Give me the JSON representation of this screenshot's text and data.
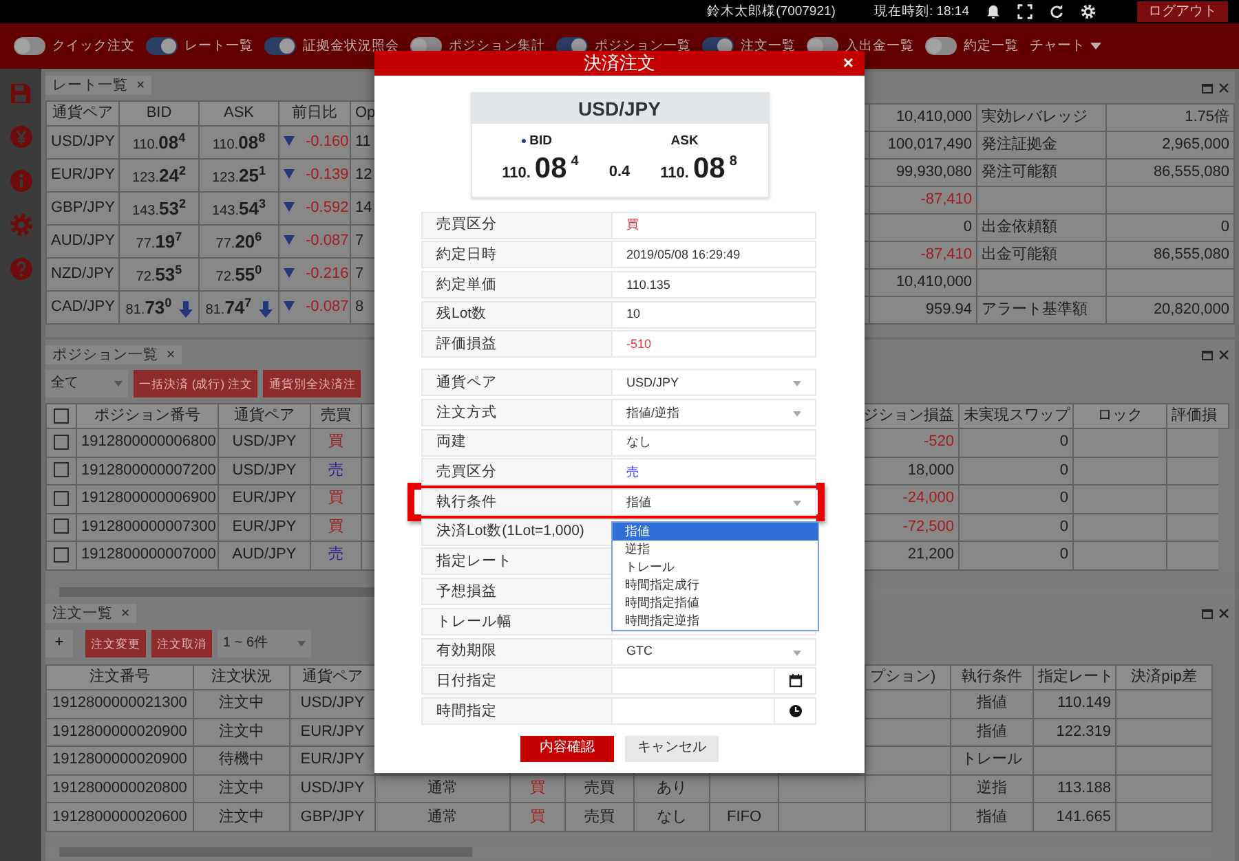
{
  "topbar": {
    "user": "鈴木太郎様(7007921)",
    "clock": "現在時刻: 18:14",
    "logout": "ログアウト"
  },
  "toolbar": {
    "toggles": [
      {
        "label": "クイック注文",
        "on": false
      },
      {
        "label": "レート一覧",
        "on": true
      },
      {
        "label": "証拠金状況照会",
        "on": true
      },
      {
        "label": "ポジション集計",
        "on": false
      },
      {
        "label": "ポジション一覧",
        "on": true
      },
      {
        "label": "注文一覧",
        "on": true
      },
      {
        "label": "入出金一覧",
        "on": false
      },
      {
        "label": "約定一覧",
        "on": false
      }
    ],
    "chart_menu": "チャート"
  },
  "rate_panel": {
    "tab": "レート一覧",
    "close": "×",
    "columns": [
      "通貨ペア",
      "BID",
      "ASK",
      "前日比",
      "Op"
    ],
    "rows": [
      {
        "pair": "USD/JPY",
        "bid": {
          "base": "110.",
          "pips": "08",
          "fraction": "4"
        },
        "ask": {
          "base": "110.",
          "pips": "08",
          "fraction": "8"
        },
        "falling": false,
        "change": "-0.160",
        "open": "11"
      },
      {
        "pair": "EUR/JPY",
        "bid": {
          "base": "123.",
          "pips": "24",
          "fraction": "2"
        },
        "ask": {
          "base": "123.",
          "pips": "25",
          "fraction": "1"
        },
        "falling": false,
        "change": "-0.139",
        "open": "12"
      },
      {
        "pair": "GBP/JPY",
        "bid": {
          "base": "143.",
          "pips": "53",
          "fraction": "2"
        },
        "ask": {
          "base": "143.",
          "pips": "54",
          "fraction": "3"
        },
        "falling": false,
        "change": "-0.592",
        "open": "14"
      },
      {
        "pair": "AUD/JPY",
        "bid": {
          "base": "77.",
          "pips": "19",
          "fraction": "7"
        },
        "ask": {
          "base": "77.",
          "pips": "20",
          "fraction": "6"
        },
        "falling": false,
        "change": "-0.087",
        "open": "7"
      },
      {
        "pair": "NZD/JPY",
        "bid": {
          "base": "72.",
          "pips": "53",
          "fraction": "5"
        },
        "ask": {
          "base": "72.",
          "pips": "55",
          "fraction": "0"
        },
        "falling": false,
        "change": "-0.216",
        "open": "7"
      },
      {
        "pair": "CAD/JPY",
        "bid": {
          "base": "81.",
          "pips": "73",
          "fraction": "0"
        },
        "ask": {
          "base": "81.",
          "pips": "74",
          "fraction": "7"
        },
        "falling": true,
        "change": "-0.087",
        "open": "8"
      }
    ]
  },
  "account_panel": {
    "rows": [
      {
        "column_2": "10,410,000",
        "negative": false,
        "column_3": "実効レバレッジ",
        "column_4": "1.75倍"
      },
      {
        "column_2": "100,017,490",
        "negative": false,
        "column_3": "発注証拠金",
        "column_4": "2,965,000"
      },
      {
        "column_2": "99,930,080",
        "negative": false,
        "column_3": "発注可能額",
        "column_4": "86,555,080"
      },
      {
        "column_2": "-87,410",
        "negative": true
      },
      {
        "column_2": "0",
        "negative": false,
        "column_3": "出金依頼額",
        "column_4": "0"
      },
      {
        "column_2": "-87,410",
        "negative": true,
        "column_3": "出金可能額",
        "column_4": "86,555,080"
      },
      {
        "column_2": "10,410,000",
        "negative": false
      },
      {
        "column_2": "959.94",
        "negative": false,
        "column_3": "アラート基準額",
        "column_4": "20,820,000"
      }
    ]
  },
  "positions_panel": {
    "tab": "ポジション一覧",
    "close": "×",
    "filter": "全て",
    "buttons": [
      "一括決済 (成行) 注文",
      "通貨別全決済注"
    ],
    "header_checked": false,
    "columns": [
      "ポジション番号",
      "通貨ペア",
      "売買",
      null,
      "ジション損益",
      "未実現スワップ",
      "ロック",
      "評価損"
    ],
    "rows": [
      {
        "checked": false,
        "cells": [
          "1912800000006800",
          "USD/JPY",
          {
            "text": "買",
            "color": "#a51c1c"
          },
          null,
          {
            "text": "-520",
            "color": "#a51c1c"
          },
          "0",
          null,
          null
        ]
      },
      {
        "checked": false,
        "cells": [
          "1912800000007200",
          "USD/JPY",
          {
            "text": "売",
            "color": "#2626a0"
          },
          null,
          "18,000",
          "0",
          null,
          null
        ]
      },
      {
        "checked": false,
        "cells": [
          "1912800000006900",
          "EUR/JPY",
          {
            "text": "買",
            "color": "#a51c1c"
          },
          null,
          {
            "text": "-24,000",
            "color": "#a51c1c"
          },
          "0",
          null,
          null
        ]
      },
      {
        "checked": false,
        "cells": [
          "1912800000007300",
          "EUR/JPY",
          {
            "text": "買",
            "color": "#a51c1c"
          },
          null,
          {
            "text": "-72,500",
            "color": "#a51c1c"
          },
          "0",
          null,
          null
        ]
      },
      {
        "checked": false,
        "cells": [
          "1912800000007000",
          "AUD/JPY",
          {
            "text": "売",
            "color": "#2626a0"
          },
          null,
          "21,200",
          "0",
          null,
          null
        ]
      }
    ]
  },
  "orders_panel": {
    "tab": "注文一覧",
    "close": "×",
    "add": "+",
    "buttons": [
      "注文変更",
      "注文取消"
    ],
    "pager": "1 ~ 6件",
    "columns": [
      "注文番号",
      "注文状況",
      "通貨ペア",
      null,
      null,
      null,
      null,
      null,
      null,
      "プション)",
      "執行条件",
      "指定レート",
      "決済pip差"
    ],
    "rows": [
      {
        "cells": [
          "1912800000021300",
          "注文中",
          "USD/JPY",
          null,
          null,
          null,
          null,
          null,
          null,
          null,
          "指値",
          "110.149",
          null
        ]
      },
      {
        "cells": [
          "1912800000020900",
          "注文中",
          "EUR/JPY",
          null,
          null,
          null,
          null,
          null,
          null,
          null,
          "指値",
          "122.319",
          null
        ]
      },
      {
        "cells": [
          "1912800000020900",
          "待機中",
          "EUR/JPY",
          null,
          null,
          null,
          null,
          null,
          null,
          null,
          "トレール",
          null,
          null
        ]
      },
      {
        "cells": [
          "1912800000020800",
          "注文中",
          "USD/JPY",
          "通常",
          {
            "text": "買",
            "color": "#a51c1c"
          },
          "売買",
          "あり",
          null,
          null,
          null,
          "逆指",
          "113.188",
          null
        ]
      },
      {
        "cells": [
          "1912800000020600",
          "注文中",
          "GBP/JPY",
          "通常",
          {
            "text": "買",
            "color": "#a51c1c"
          },
          "売買",
          "なし",
          "FIFO",
          null,
          null,
          "指値",
          "141.665",
          null
        ]
      }
    ]
  },
  "modal": {
    "title": "決済注文",
    "close": "×",
    "quote": {
      "pair": "USD/JPY",
      "bid_label": "BID",
      "ask_label": "ASK",
      "bid": {
        "base": "110.",
        "pips": "08",
        "fraction": "4"
      },
      "spread": "0.4",
      "ask": {
        "base": "110.",
        "pips": "08",
        "fraction": "8"
      }
    },
    "info_rows": [
      {
        "label": "売買区分",
        "value": "買",
        "color": "#e8323c"
      },
      {
        "label": "約定日時",
        "value": "2019/05/08 16:29:49"
      },
      {
        "label": "約定単価",
        "value": "110.135"
      },
      {
        "label": "残Lot数",
        "value": "10"
      },
      {
        "label": "評価損益",
        "value": "-510",
        "color": "#e8323c"
      }
    ],
    "form_rows": [
      {
        "kind": "select",
        "label": "通貨ペア",
        "value": "USD/JPY",
        "expanded": false,
        "highlighted": false
      },
      {
        "kind": "select",
        "label": "注文方式",
        "value": "指値/逆指",
        "expanded": false,
        "highlighted": false
      },
      {
        "kind": "text",
        "label": "両建",
        "value": "なし",
        "highlighted": false
      },
      {
        "kind": "text",
        "label": "売買区分",
        "value": "売",
        "color": "#3a3aff",
        "highlighted": false
      },
      {
        "kind": "select",
        "label": "執行条件",
        "value": "指値",
        "expanded": true,
        "highlighted": true,
        "options": [
          {
            "label": "指値",
            "selected": true
          },
          {
            "label": "逆指",
            "selected": false
          },
          {
            "label": "トレール",
            "selected": false
          },
          {
            "label": "時間指定成行",
            "selected": false
          },
          {
            "label": "時間指定指値",
            "selected": false
          },
          {
            "label": "時間指定逆指",
            "selected": false
          }
        ]
      },
      {
        "kind": "text",
        "label": "決済Lot数(1Lot=1,000)",
        "highlighted": false
      },
      {
        "kind": "text",
        "label": "指定レート",
        "highlighted": false
      },
      {
        "kind": "text",
        "label": "予想損益",
        "highlighted": false
      },
      {
        "kind": "text",
        "label": "トレール幅",
        "highlighted": false
      },
      {
        "kind": "select",
        "label": "有効期限",
        "value": "GTC",
        "expanded": false,
        "highlighted": false
      },
      {
        "kind": "date",
        "label": "日付指定",
        "highlighted": false
      },
      {
        "kind": "time",
        "label": "時間指定",
        "highlighted": false
      }
    ],
    "buttons": [
      {
        "label": "内容確認",
        "kind": "primary"
      },
      {
        "label": "キャンセル",
        "kind": "secondary"
      }
    ]
  }
}
